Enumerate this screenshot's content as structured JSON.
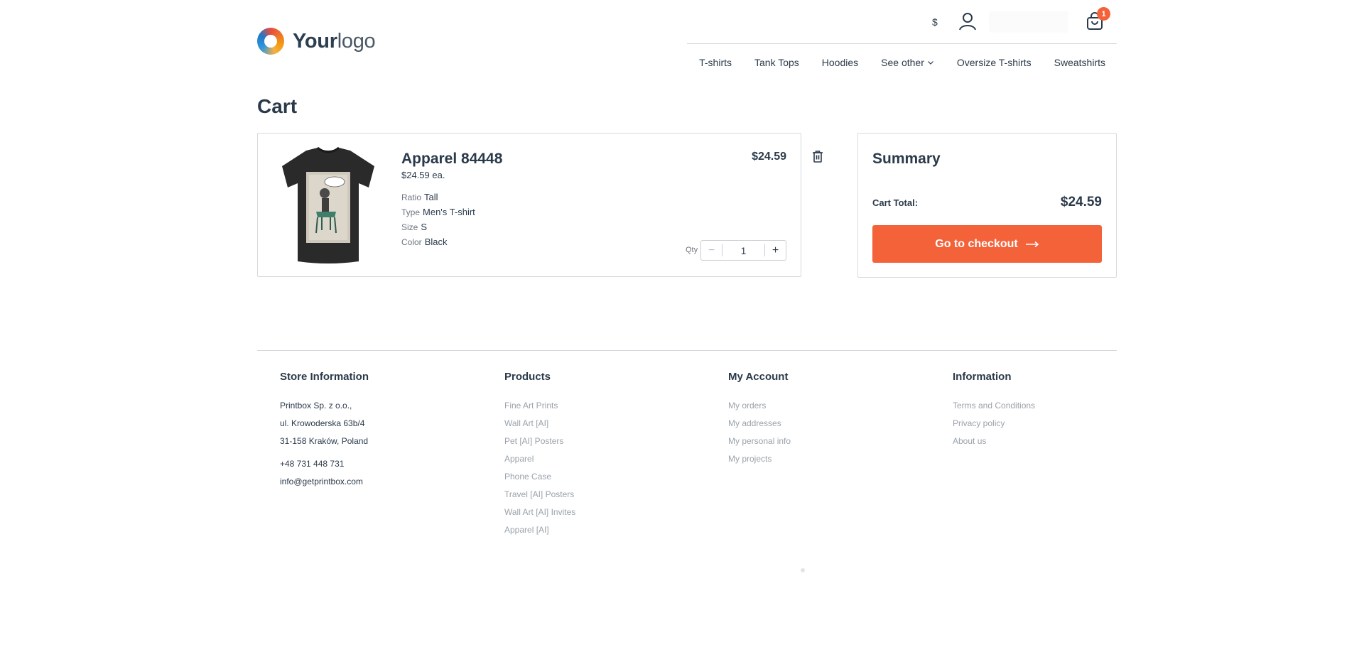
{
  "header": {
    "logo_bold": "Your",
    "logo_light": "logo",
    "currency": "$",
    "cart_count": "1",
    "nav": [
      "T-shirts",
      "Tank Tops",
      "Hoodies",
      "See other",
      "Oversize T-shirts",
      "Sweatshirts"
    ]
  },
  "page": {
    "title": "Cart"
  },
  "cart_item": {
    "name": "Apparel 84448",
    "each": "$24.59 ea.",
    "price": "$24.59",
    "attributes": [
      {
        "key": "Ratio",
        "value": "Tall"
      },
      {
        "key": "Type",
        "value": "Men's T-shirt"
      },
      {
        "key": "Size",
        "value": "S"
      },
      {
        "key": "Color",
        "value": "Black"
      }
    ],
    "qty_label": "Qty",
    "qty": "1",
    "minus": "−",
    "plus": "+"
  },
  "summary": {
    "title": "Summary",
    "total_label": "Cart Total:",
    "total_value": "$24.59",
    "checkout_label": "Go to checkout"
  },
  "footer": {
    "store": {
      "title": "Store Information",
      "address": [
        "Printbox Sp. z o.o.,",
        "ul. Krowoderska 63b/4",
        "31-158 Kraków, Poland"
      ],
      "phone": "+48 731 448 731",
      "email": "info@getprintbox.com"
    },
    "products": {
      "title": "Products",
      "links": [
        "Fine Art Prints",
        "Wall Art [AI]",
        "Pet [AI] Posters",
        "Apparel",
        "Phone Case",
        "Travel [AI] Posters",
        "Wall Art [AI] Invites",
        "Apparel [AI]"
      ]
    },
    "account": {
      "title": "My Account",
      "links": [
        "My orders",
        "My addresses",
        "My personal info",
        "My projects"
      ]
    },
    "information": {
      "title": "Information",
      "links": [
        "Terms and Conditions",
        "Privacy policy",
        "About us"
      ]
    }
  },
  "colors": {
    "accent": "#f4623a",
    "text": "#2b3a4a",
    "muted": "#9aa2aa"
  }
}
